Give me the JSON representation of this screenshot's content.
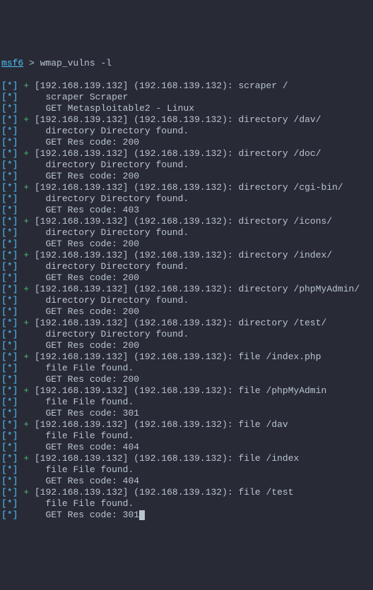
{
  "prompt": {
    "prefix": "msf6",
    "sep": " > ",
    "command": "wmap_vulns -l"
  },
  "entries": [
    {
      "header": "+ [192.168.139.132] (192.168.139.132): scraper /",
      "desc": "scraper Scraper",
      "res": "GET Metasploitable2 - Linux"
    },
    {
      "header": "+ [192.168.139.132] (192.168.139.132): directory /dav/",
      "desc": "directory Directory found.",
      "res": "GET Res code: 200"
    },
    {
      "header": "+ [192.168.139.132] (192.168.139.132): directory /doc/",
      "desc": "directory Directory found.",
      "res": "GET Res code: 200"
    },
    {
      "header": "+ [192.168.139.132] (192.168.139.132): directory /cgi-bin/",
      "desc": "directory Directory found.",
      "res": "GET Res code: 403"
    },
    {
      "header": "+ [192.168.139.132] (192.168.139.132): directory /icons/",
      "desc": "directory Directory found.",
      "res": "GET Res code: 200"
    },
    {
      "header": "+ [192.168.139.132] (192.168.139.132): directory /index/",
      "desc": "directory Directory found.",
      "res": "GET Res code: 200"
    },
    {
      "header": "+ [192.168.139.132] (192.168.139.132): directory /phpMyAdmin/",
      "desc": "directory Directory found.",
      "res": "GET Res code: 200"
    },
    {
      "header": "+ [192.168.139.132] (192.168.139.132): directory /test/",
      "desc": "directory Directory found.",
      "res": "GET Res code: 200"
    },
    {
      "header": "+ [192.168.139.132] (192.168.139.132): file /index.php",
      "desc": "file File found.",
      "res": "GET Res code: 200"
    },
    {
      "header": "+ [192.168.139.132] (192.168.139.132): file /phpMyAdmin",
      "desc": "file File found.",
      "res": "GET Res code: 301"
    },
    {
      "header": "+ [192.168.139.132] (192.168.139.132): file /dav",
      "desc": "file File found.",
      "res": "GET Res code: 404"
    },
    {
      "header": "+ [192.168.139.132] (192.168.139.132): file /index",
      "desc": "file File found.",
      "res": "GET Res code: 404"
    },
    {
      "header": "+ [192.168.139.132] (192.168.139.132): file /test",
      "desc": "file File found.",
      "res": "GET Res code: 301"
    }
  ],
  "marker": "[*]",
  "indent1": " ",
  "indent2": "     "
}
